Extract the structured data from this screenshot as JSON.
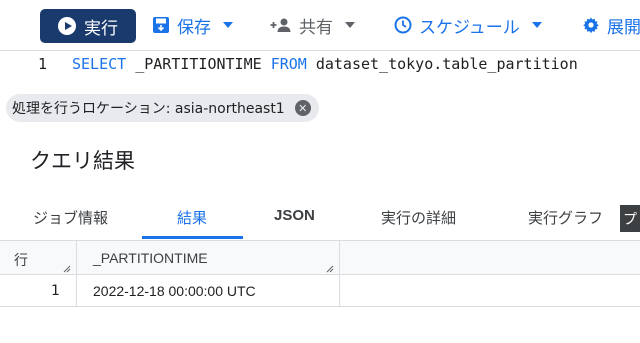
{
  "toolbar": {
    "run_label": "実行",
    "save_label": "保存",
    "share_label": "共有",
    "schedule_label": "スケジュール",
    "deploy_label": "展開"
  },
  "editor": {
    "line_number": "1",
    "kw_select": "SELECT",
    "col": " _PARTITIONTIME ",
    "kw_from": "FROM",
    "table": " dataset_tokyo.table_partition"
  },
  "location_chip": "処理を行うロケーション: asia-northeast1",
  "results_title": "クエリ結果",
  "tabs": [
    {
      "label": "ジョブ情報"
    },
    {
      "label": "結果"
    },
    {
      "label": "JSON"
    },
    {
      "label": "実行の詳細"
    },
    {
      "label": "実行グラフ"
    }
  ],
  "tab_overflow": "プ",
  "table": {
    "headers": [
      "行",
      "_PARTITIONTIME"
    ],
    "rows": [
      {
        "row": "1",
        "partitiontime": "2022-12-18 00:00:00 UTC"
      }
    ]
  },
  "colors": {
    "accent": "#1a73e8",
    "run_button": "#1a3a6e"
  }
}
